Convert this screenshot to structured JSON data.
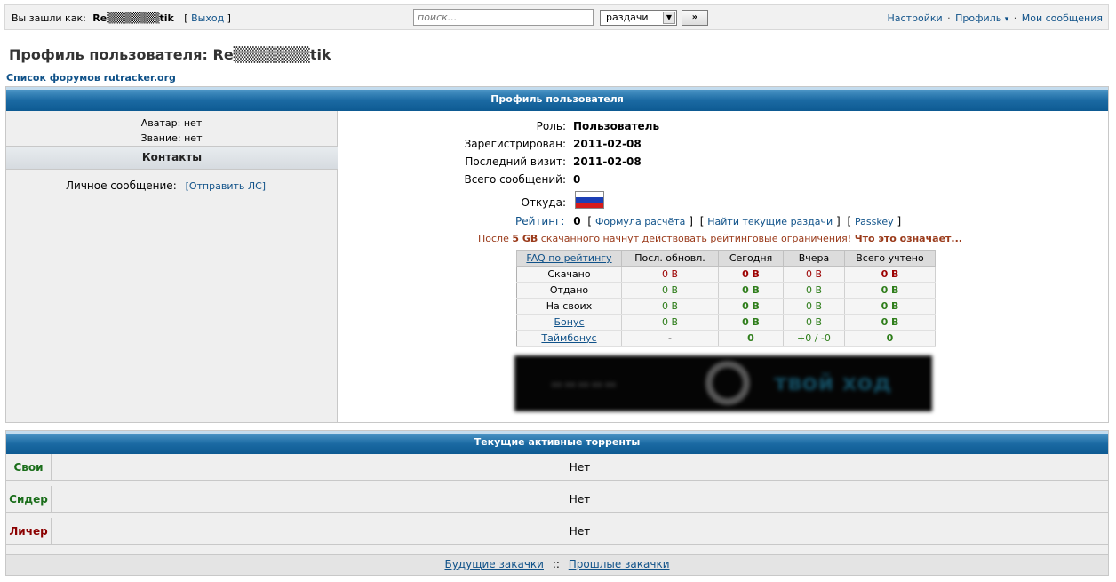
{
  "topbar": {
    "logged_in_label": "Вы зашли как:",
    "username": "Re▒▒▒▒▒▒▒tik",
    "logout_label": "Выход",
    "search_placeholder": "поиск...",
    "search_scope": "раздачи",
    "search_go": "»",
    "links": {
      "settings": "Настройки",
      "profile": "Профиль",
      "messages": "Мои сообщения"
    }
  },
  "page": {
    "title": "Профиль пользователя: Re▒▒▒▒▒▒▒tik",
    "forum_list_link": "Список форумов rutracker.org"
  },
  "profile": {
    "header": "Профиль пользователя",
    "avatar": {
      "label": "Аватар:",
      "value": "нет"
    },
    "rank": {
      "label": "Звание:",
      "value": "нет"
    },
    "contacts_header": "Контакты",
    "pm": {
      "label": "Личное сообщение:",
      "link": "[Отправить ЛС]"
    },
    "info": [
      {
        "label": "Роль:",
        "value": "Пользователь"
      },
      {
        "label": "Зарегистрирован:",
        "value": "2011-02-08"
      },
      {
        "label": "Последний визит:",
        "value": "2011-02-08"
      },
      {
        "label": "Всего сообщений:",
        "value": "0"
      }
    ],
    "from_label": "Откуда:",
    "flag_colors": [
      "#ffffff",
      "#1c3fb5",
      "#d51b1b"
    ],
    "rating": {
      "label": "Рейтинг:",
      "value": "0",
      "formula_link": "Формула расчёта",
      "find_link": "Найти текущие раздачи",
      "passkey_link": "Passkey"
    },
    "warning": {
      "before": "После",
      "amount": "5 GB",
      "after": "скачанного начнут действовать рейтинговые ограничения!",
      "link": "Что это означает..."
    },
    "stats": {
      "headers": [
        "FAQ по рейтингу",
        "Посл. обновл.",
        "Сегодня",
        "Вчера",
        "Всего учтено"
      ],
      "rows": [
        {
          "label": "Скачано",
          "cells": [
            "0 B",
            "0 B",
            "0 B",
            "0 B"
          ]
        },
        {
          "label": "Отдано",
          "cells": [
            "0 B",
            "0 B",
            "0 B",
            "0 B"
          ]
        },
        {
          "label": "На своих",
          "cells": [
            "0 B",
            "0 B",
            "0 B",
            "0 B"
          ]
        },
        {
          "label": "Бонус",
          "cells": [
            "0 B",
            "0 B",
            "0 B",
            "0 B"
          ]
        },
        {
          "label": "Таймбонус",
          "cells": [
            "-",
            "0",
            "+0 / -0",
            "0"
          ]
        }
      ]
    },
    "banner_text": "твой ход"
  },
  "torrents": {
    "header": "Текущие активные торренты",
    "rows": [
      {
        "label": "Свои",
        "value": "Нет",
        "color": "#1b6e1b"
      },
      {
        "label": "Сидер",
        "value": "Нет",
        "color": "#1b6e1b"
      },
      {
        "label": "Личер",
        "value": "Нет",
        "color": "#8b0000"
      }
    ],
    "future_link": "Будущие закачки",
    "separator": "::",
    "past_link": "Прошлые закачки"
  }
}
